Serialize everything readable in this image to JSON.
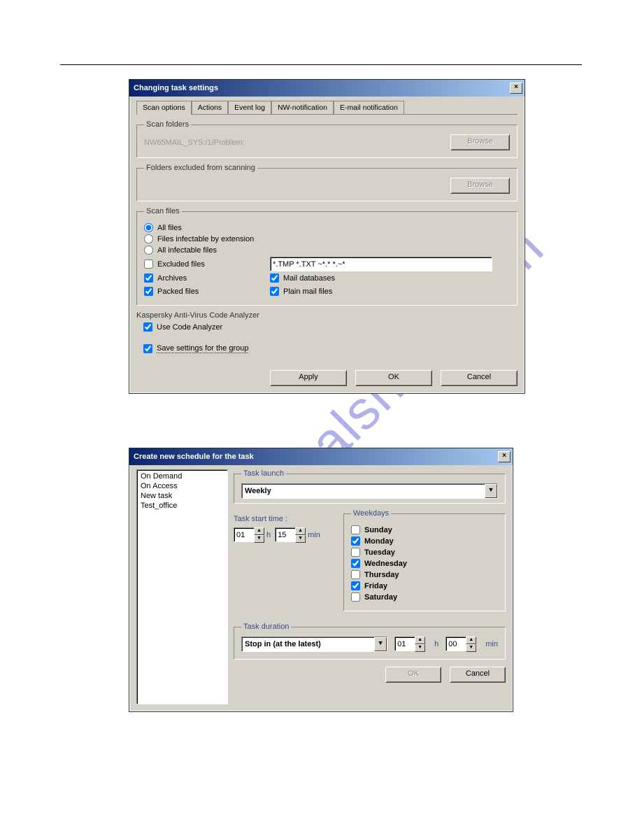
{
  "watermark": "manualshive.com",
  "dialog1": {
    "title": "Changing task settings",
    "close_glyph": "×",
    "tabs": {
      "scan_options": "Scan options",
      "actions": "Actions",
      "event_log": "Event log",
      "nw_notification": "NW-notification",
      "email_notification": "E-mail notification"
    },
    "scan_folders": {
      "legend": "Scan folders",
      "path": "NW65MAIL_SYS:/1/Problem;",
      "browse": "Browse"
    },
    "excluded": {
      "legend": "Folders excluded from scanning",
      "browse": "Browse"
    },
    "scan_files": {
      "legend": "Scan files",
      "all_files": "All files",
      "files_infectable_ext": "Files infectable by extension",
      "all_infectable": "All infectable files",
      "excluded_files": "Excluded files",
      "excluded_pattern": "*.TMP *.TXT ~*.* *.~*",
      "archives": "Archives",
      "packed_files": "Packed files",
      "mail_databases": "Mail databases",
      "plain_mail": "Plain mail files"
    },
    "analyzer": {
      "title": "Kaspersky Anti-Virus Code Analyzer",
      "use_code": "Use Code Analyzer"
    },
    "save_settings": "Save settings for the group",
    "buttons": {
      "apply": "Apply",
      "ok": "OK",
      "cancel": "Cancel"
    }
  },
  "dialog2": {
    "title": "Create new schedule for the task",
    "close_glyph": "×",
    "list": [
      "On Demand",
      "On Access",
      "New task",
      "Test_office"
    ],
    "task_launch": {
      "legend": "Task launch",
      "value": "Weekly"
    },
    "start_time": {
      "label": "Task start time :",
      "h_value": "01",
      "h_unit": "h",
      "m_value": "15",
      "m_unit": "min"
    },
    "weekdays": {
      "legend": "Weekdays",
      "sunday": "Sunday",
      "monday": "Monday",
      "tuesday": "Tuesday",
      "wednesday": "Wednesday",
      "thursday": "Thursday",
      "friday": "Friday",
      "saturday": "Saturday"
    },
    "duration": {
      "legend": "Task duration",
      "stop_in": "Stop in (at the latest)",
      "h_value": "01",
      "h_unit": "h",
      "m_value": "00",
      "m_unit": "min"
    },
    "buttons": {
      "ok": "OK",
      "cancel": "Cancel"
    }
  }
}
